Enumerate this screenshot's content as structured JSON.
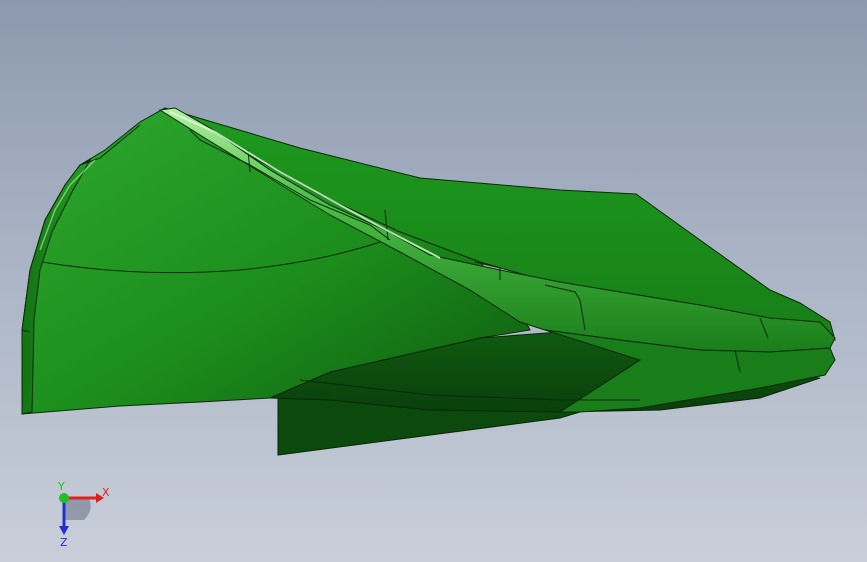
{
  "viewport": {
    "background_top": "#8c99ae",
    "background_bottom": "#c9cfda"
  },
  "model": {
    "name": "green-swept-shell-part",
    "color": "#1f9a1f",
    "edge_color": "#0a2a0a"
  },
  "triad": {
    "x_label": "X",
    "y_label": "Y",
    "z_label": "Z",
    "x_color": "#e02020",
    "y_color": "#20c020",
    "z_color": "#2030d0"
  }
}
